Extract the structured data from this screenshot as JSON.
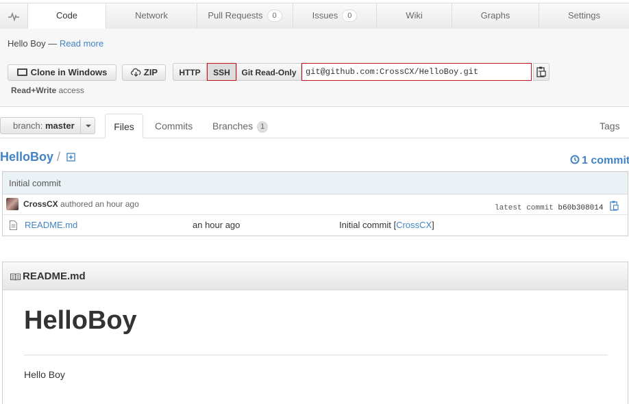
{
  "tabs": [
    {
      "label": "",
      "icon": "pulse-icon"
    },
    {
      "label": "Code",
      "active": true
    },
    {
      "label": "Network"
    },
    {
      "label": "Pull Requests",
      "count": "0"
    },
    {
      "label": "Issues",
      "count": "0"
    },
    {
      "label": "Wiki"
    },
    {
      "label": "Graphs"
    },
    {
      "label": "Settings"
    }
  ],
  "repo": {
    "description": "Hello Boy",
    "separator": " — ",
    "read_more": "Read more"
  },
  "clone": {
    "clone_windows": "Clone in Windows",
    "zip": "ZIP",
    "protocols": [
      "HTTP",
      "SSH",
      "Git Read-Only"
    ],
    "selected_protocol": "SSH",
    "url": "git@github.com:CrossCX/HelloBoy.git",
    "access_strong": "Read+Write",
    "access_text": " access"
  },
  "filenav": {
    "branch_prefix": "branch: ",
    "branch_name": "master",
    "tabs": {
      "files": "Files",
      "commits": "Commits",
      "branches": "Branches",
      "branches_count": "1",
      "tags": "Tags"
    }
  },
  "breadcrumb": {
    "repo": "HelloBoy",
    "slash": "/"
  },
  "commits_link": "1 commit",
  "browser": {
    "commit_message": "Initial commit",
    "author": "CrossCX",
    "authored": " authored an hour ago",
    "latest_label": "latest commit ",
    "sha": "b60b308014",
    "files": [
      {
        "name": "README.md",
        "age": "an hour ago",
        "message": "Initial commit [",
        "author": "CrossCX",
        "close": "]"
      }
    ]
  },
  "readme": {
    "filename": "README.md",
    "heading": "HelloBoy",
    "body": "Hello Boy"
  },
  "colors": {
    "link": "#4183c4",
    "active_tab_border": "#d26911",
    "highlight": "#c4141b"
  }
}
